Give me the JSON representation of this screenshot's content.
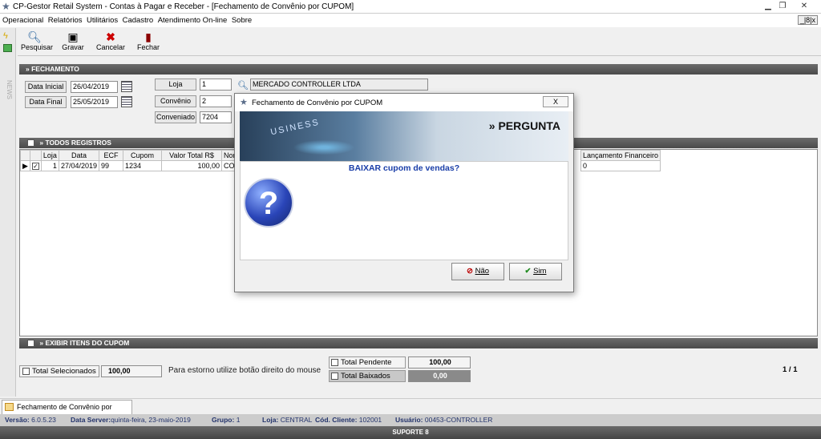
{
  "window": {
    "title": "CP-Gestor Retail System - Contas à Pagar e Receber - [Fechamento de Convênio por CUPOM]"
  },
  "menu": [
    "Operacional",
    "Relatórios",
    "Utilitários",
    "Cadastro",
    "Atendimento On-line",
    "Sobre"
  ],
  "mdi_controls": "_|8|x",
  "toolbar": {
    "search": "Pesquisar",
    "save": "Gravar",
    "cancel": "Cancelar",
    "close": "Fechar"
  },
  "fechamento": {
    "header": "» FECHAMENTO",
    "data_inicial_label": "Data Inicial",
    "data_inicial": "26/04/2019",
    "data_final_label": "Data Final",
    "data_final": "25/05/2019",
    "loja_label": "Loja",
    "loja": "1",
    "loja_nome": "MERCADO CONTROLLER LTDA",
    "convenio_label": "Convênio",
    "convenio": "2",
    "conveniado_label": "Conveniado",
    "conveniado": "7204"
  },
  "registros": {
    "header": "» TODOS REGISTROS",
    "columns": [
      "Loja",
      "Data",
      "ECF",
      "Cupom",
      "Valor Total R$",
      "Nome",
      "Lançamento Financeiro"
    ],
    "rows": [
      {
        "loja": "1",
        "data": "27/04/2019",
        "ecf": "99",
        "cupom": "1234",
        "valor": "100,00",
        "nome": "CON",
        "lanc": "0"
      }
    ]
  },
  "itens_header": "» EXIBIR ITENS DO CUPOM",
  "totals": {
    "selecionados_label": "Total Selecionados",
    "selecionados": "100,00",
    "hint": "Para estorno utilize botão direito do mouse",
    "pendente_label": "Total Pendente",
    "pendente": "100,00",
    "baixados_label": "Total Baixados",
    "baixados": "0,00",
    "page": "1 / 1"
  },
  "taskbar_tab": "Fechamento de Convênio por CUPOM",
  "status": {
    "versao_label": "Versão:",
    "versao": "6.0.5.23",
    "server_label": "Data Server:",
    "server": "quinta-feira, 23-maio-2019",
    "grupo_label": "Grupo:",
    "grupo": "1",
    "loja_label": "Loja:",
    "loja": "CENTRAL",
    "cliente_label": "Cód. Cliente:",
    "cliente": "102001",
    "usuario_label": "Usuário:",
    "usuario": "00453-CONTROLLER"
  },
  "support": "SUPORTE 8",
  "dialog": {
    "title": "Fechamento de Convênio por CUPOM",
    "close": "X",
    "banner": "» PERGUNTA",
    "banner_word": "USINESS",
    "icon": "?",
    "question": "BAIXAR cupom de vendas?",
    "no": "Não",
    "yes": "Sim"
  }
}
